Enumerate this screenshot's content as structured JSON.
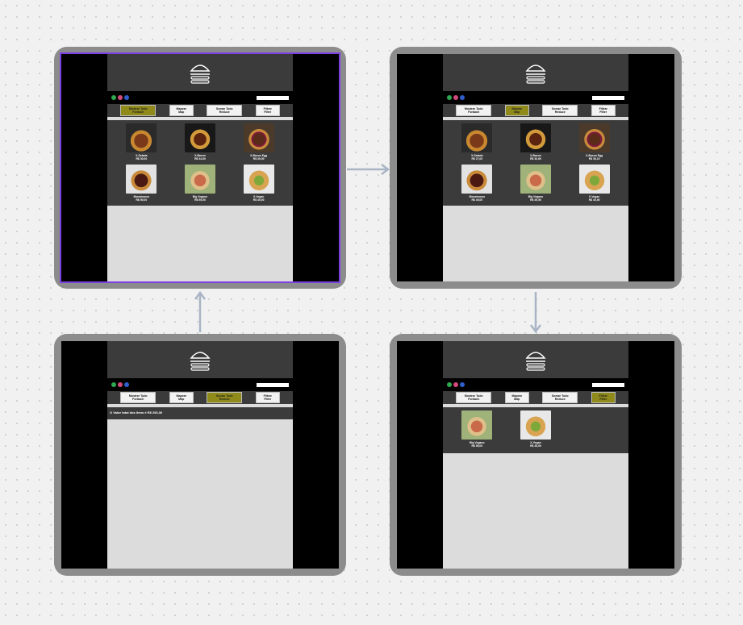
{
  "menu": [
    {
      "label": "Mostrar Tudo",
      "sub": "Forbach"
    },
    {
      "label": "Mapear",
      "sub": "Map"
    },
    {
      "label": "Somar Tudo",
      "sub": "Reduce"
    },
    {
      "label": "Filtrar",
      "sub": "Filter"
    }
  ],
  "products_full": [
    {
      "name": "X-Salada",
      "price": "R$ 30,00"
    },
    {
      "name": "X-Bacon",
      "price": "R$ 34,00"
    },
    {
      "name": "X-Bacon Egg",
      "price": "R$ 39,00"
    },
    {
      "name": "Monstruoso",
      "price": "R$ 50,00"
    },
    {
      "name": "Big Vegano",
      "price": "R$ 55,00"
    },
    {
      "name": "X-Vegan",
      "price": "R$ 45,00"
    }
  ],
  "products_mapped": [
    {
      "name": "X-Salada",
      "price": "R$ 27,00"
    },
    {
      "name": "X-Bacon",
      "price": "R$ 30,60"
    },
    {
      "name": "X-Bacon Egg",
      "price": "R$ 35,10"
    },
    {
      "name": "Monstruoso",
      "price": "R$ 45,00"
    },
    {
      "name": "Big Vegano",
      "price": "R$ 49,50"
    },
    {
      "name": "X-Vegan",
      "price": "R$ 40,50"
    }
  ],
  "products_filtered": [
    {
      "name": "Big Vegano",
      "price": "R$ 55,00"
    },
    {
      "name": "X-Vegan",
      "price": "R$ 45,00"
    }
  ],
  "reduce_message": "O Valor total dos itens é R$ 253,00",
  "colors": {
    "active": "#8f8a1a",
    "selection": "#7b3fe4",
    "arrow": "#a9b4c4"
  }
}
